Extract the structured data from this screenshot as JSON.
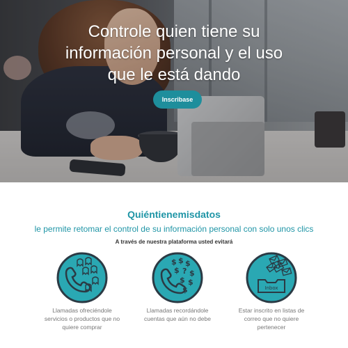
{
  "hero": {
    "title": "Controle quien tiene su información personal y el uso que le está dando",
    "cta_label": "Inscribase"
  },
  "intro": {
    "brand": "Quiéntienemisdatos",
    "tagline": "le permite retomar el control de su información personal con solo unos clics",
    "subline": "A través de nuestra plataforma usted evitará"
  },
  "features": [
    {
      "icon": "phone-ghosts-icon",
      "caption": "Llamadas ofreciéndole servicios o productos que no quiere comprar"
    },
    {
      "icon": "phone-money-icon",
      "caption": "Llamadas recordándole cuentas que aún no debe"
    },
    {
      "icon": "inbox-mail-icon",
      "caption": "Estar inscrito en listas de correo que no quiere pertenecer",
      "inbox_label": "Inbox"
    }
  ],
  "colors": {
    "accent": "#1f95a6",
    "button": "#1e8e9c",
    "icon_fill": "#2aa8b3",
    "icon_ring": "#2b3a44"
  }
}
